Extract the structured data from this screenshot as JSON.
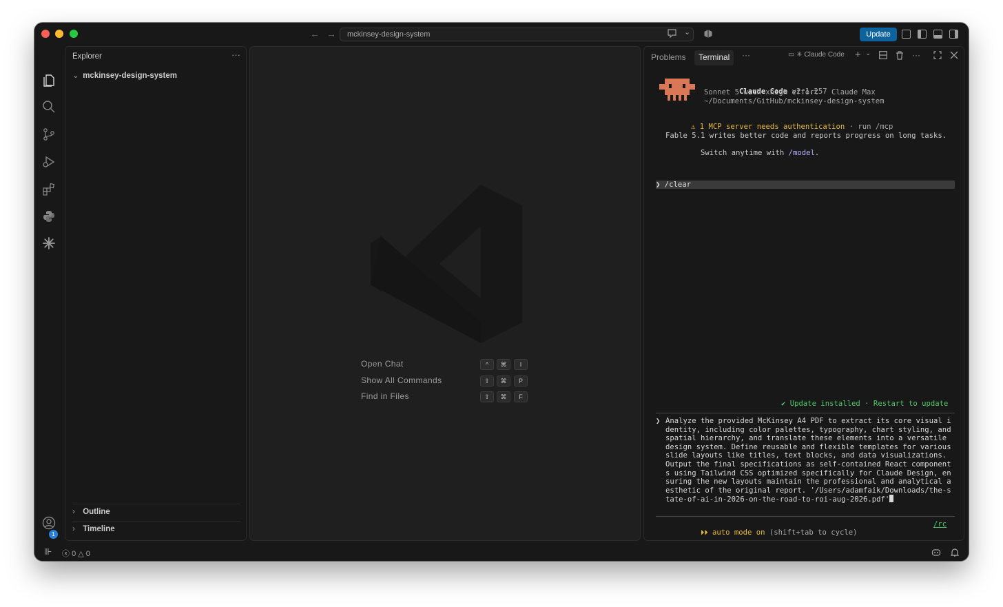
{
  "titlebar": {
    "search_text": "mckinsey-design-system",
    "update_label": "Update"
  },
  "sidebar": {
    "title": "Explorer",
    "more": "···",
    "folder_name": "mckinsey-design-system",
    "sections": [
      {
        "label": "Outline"
      },
      {
        "label": "Timeline"
      }
    ]
  },
  "activity": {
    "settings_badge": "1"
  },
  "editor": {
    "shortcuts": [
      {
        "label": "Open Chat",
        "keys": [
          "^",
          "⌘",
          "I"
        ]
      },
      {
        "label": "Show All Commands",
        "keys": [
          "⇧",
          "⌘",
          "P"
        ]
      },
      {
        "label": "Find in Files",
        "keys": [
          "⇧",
          "⌘",
          "F"
        ]
      }
    ]
  },
  "panel": {
    "tabs": [
      {
        "label": "Problems",
        "active": false
      },
      {
        "label": "Terminal",
        "active": true
      }
    ],
    "more": "···",
    "terminal_name": "Claude Code"
  },
  "terminal": {
    "app_name": "Claude Code",
    "version": "v2.1.257",
    "model_line": "Sonnet 5 with xhigh effort · Claude Max",
    "cwd": "~/Documents/GitHub/mckinsey-design-system",
    "warning_main": "⚠ 1 MCP server needs authentication",
    "warning_hint": " · run /mcp",
    "info_line1": "Fable 5.1 writes better code and reports progress on long tasks.",
    "info_line2_prefix": "Switch anytime with ",
    "info_line2_link": "/model",
    "info_line2_suffix": ".",
    "command": "❯ /clear",
    "update_notice": "✔ Update installed · Restart to update",
    "prompt_symbol": "❯",
    "prompt": "Analyze the provided McKinsey A4 PDF to extract its core visual identity, including color palettes, typography, chart styling, and spatial hierarchy, and translate these elements into a versatile design system. Define reusable and flexible templates for various slide layouts like titles, text blocks, and data visualizations. Output the final specifications as self-contained React components using Tailwind CSS optimized specifically for Claude Design, ensuring the new layouts maintain the professional and analytical aesthetic of the original report. '/Users/adamfaik/Downloads/the-state-of-ai-in-2026-on-the-road-to-roi-aug-2026.pdf'",
    "mode_main": "⏵⏵ auto mode on",
    "mode_hint": " (shift+tab to cycle)",
    "rc": "/rc"
  },
  "statusbar": {
    "errors": "0",
    "warnings": "0"
  },
  "colors": {
    "accent": "#0e639c",
    "warning": "#e5b93c",
    "success": "#4ec96a",
    "mascot": "#d97757"
  }
}
